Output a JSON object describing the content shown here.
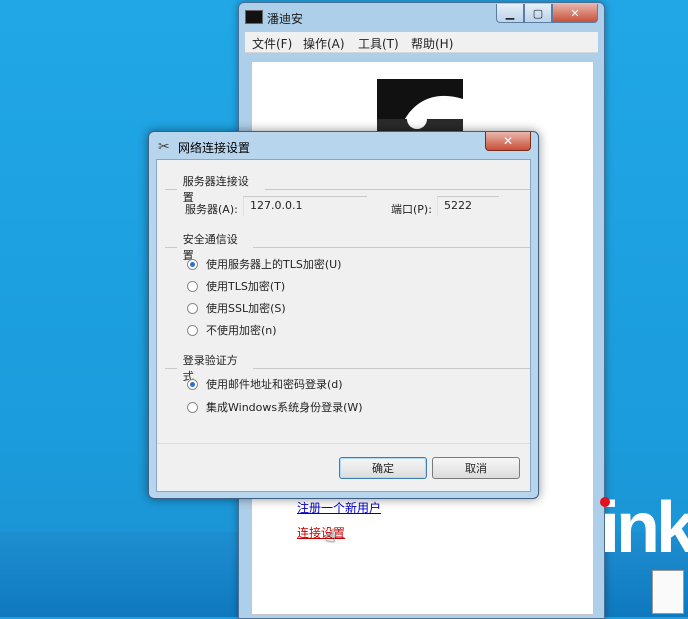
{
  "app": {
    "title": "潘迪安",
    "menu": [
      "文件(F)",
      "操作(A)",
      "工具(T)",
      "帮助(H)"
    ],
    "links": {
      "register": "注册一个新用户",
      "connection_settings": "连接设置"
    }
  },
  "dialog": {
    "title": "网络连接设置",
    "server_group": "服务器连接设置",
    "server_label": "服务器(A):",
    "server_value": "127.0.0.1",
    "port_label": "端口(P):",
    "port_value": "5222",
    "security_group": "安全通信设置",
    "security_options": [
      {
        "label": "使用服务器上的TLS加密(U)",
        "selected": true
      },
      {
        "label": "使用TLS加密(T)",
        "selected": false
      },
      {
        "label": "使用SSL加密(S)",
        "selected": false
      },
      {
        "label": "不使用加密(n)",
        "selected": false
      }
    ],
    "auth_group": "登录验证方式",
    "auth_options": [
      {
        "label": "使用邮件地址和密码登录(d)",
        "selected": true
      },
      {
        "label": "集成Windows系统身份登录(W)",
        "selected": false
      }
    ],
    "ok_label": "确定",
    "cancel_label": "取消"
  },
  "desktop": {
    "brand_text": "ink"
  },
  "colors": {
    "desktop": "#1ea0df",
    "titlebar": "#b8d5ee",
    "link": "#0000cc",
    "active_link": "#cc0000",
    "radio_dot": "#2b6fd2"
  },
  "icons": [
    "app-logo-icon",
    "minimize-icon",
    "maximize-icon",
    "close-icon",
    "tools-icon",
    "cursor-hand-icon",
    "notepad-icon"
  ]
}
